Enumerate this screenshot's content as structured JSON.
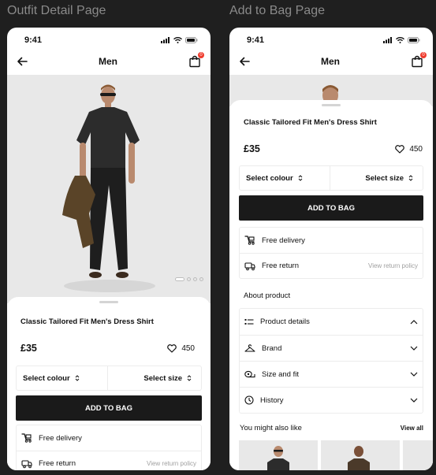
{
  "frames": {
    "left_title": "Outfit Detail Page",
    "right_title": "Add to Bag Page"
  },
  "status": {
    "time": "9:41"
  },
  "header": {
    "title": "Men",
    "bag_count": "0"
  },
  "gallery": {
    "page_count": 4,
    "current_page": 1
  },
  "product": {
    "title": "Classic Tailored Fit Men's Dress Shirt",
    "price": "£35",
    "likes": "450",
    "select_colour": "Select colour",
    "select_size": "Select size",
    "add_to_bag": "ADD TO BAG"
  },
  "services": {
    "free_delivery": "Free delivery",
    "free_return": "Free return",
    "view_return_policy": "View return policy"
  },
  "about": {
    "heading": "About product",
    "items": [
      "Product details",
      "Brand",
      "Size and fit",
      "History"
    ]
  },
  "recommendations": {
    "heading": "You might also like",
    "view_all": "View all"
  },
  "colors": {
    "accent": "#1a1a1a",
    "badge": "#ef3b2d",
    "background": "#1f1f1f"
  }
}
